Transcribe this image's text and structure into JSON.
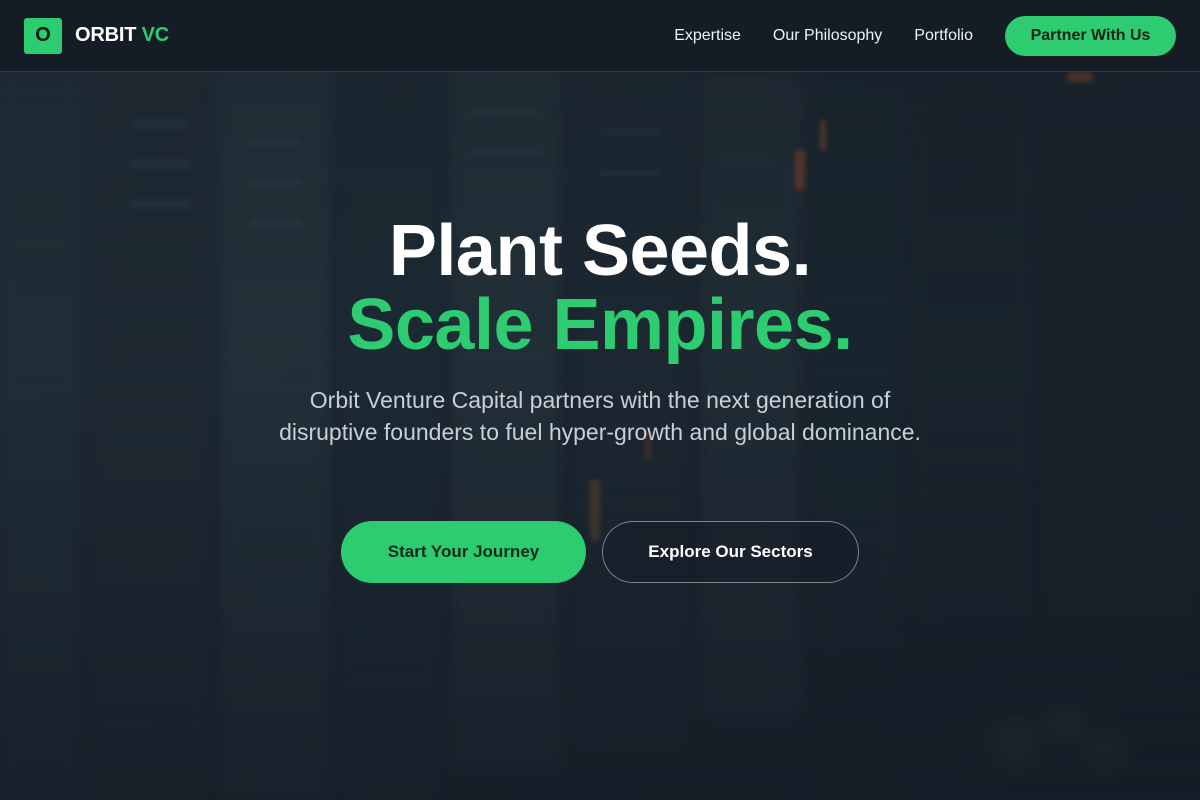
{
  "nav": {
    "logo_letter": "O",
    "brand_primary": "ORBIT",
    "brand_accent": "VC",
    "links": [
      "Expertise",
      "Our Philosophy",
      "Portfolio"
    ],
    "cta_label": "Partner With Us"
  },
  "hero": {
    "headline_line1": "Plant Seeds.",
    "headline_line2": "Scale Empires.",
    "subtext": "Orbit Venture Capital partners with the next generation of disruptive founders to fuel hyper-growth and global dominance.",
    "primary_button": "Start Your Journey",
    "secondary_button": "Explore Our Sectors",
    "background": "blurred-server-rack-photo"
  },
  "colors": {
    "accent": "#2ecc71",
    "background": "#182029",
    "text": "#ffffff",
    "subtext": "#c9cfd6"
  }
}
